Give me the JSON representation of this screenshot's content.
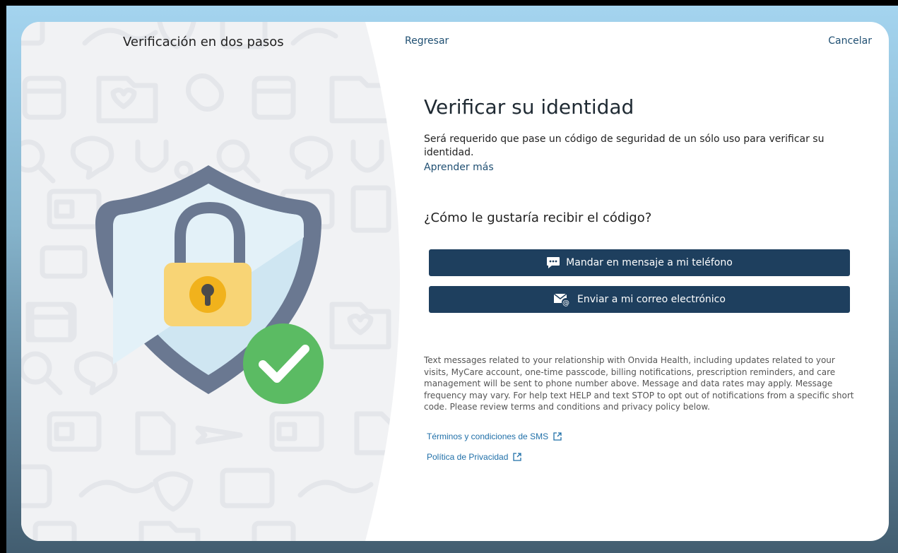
{
  "header": {
    "panel_title": "Verificación en dos pasos",
    "back_label": "Regresar",
    "cancel_label": "Cancelar"
  },
  "main": {
    "heading": "Verificar su identidad",
    "intro": "Será requerido que pase un código de seguridad de un sólo uso para verificar su identidad.",
    "learn_more": "Aprender más",
    "question": "¿Cómo le gustaría recibir el código?",
    "sms_button": {
      "label": "Mandar en mensaje a mi teléfono",
      "icon": "chat-bubble-icon"
    },
    "email_button": {
      "label": "Enviar a mi correo electrónico",
      "icon": "envelope-at-icon"
    }
  },
  "footer": {
    "disclaimer": "Text messages related to your relationship with Onvida Health, including updates related to your visits, MyCare account, one-time passcode, billing notifications, prescription reminders, and care management will be sent to phone number above. Message and data rates may apply. Message frequency may vary. For help text HELP and text STOP to opt out of notifications from a specific short code. Please review terms and conditions and privacy policy below.",
    "sms_terms": "Términos y condiciones de SMS",
    "privacy_policy": "Política de Privacidad"
  },
  "colors": {
    "primary_button": "#1e3f5e",
    "link": "#1f4f72",
    "shield_outer": "#6a7891",
    "shield_inner": "#cfe6f2",
    "lock_body": "#f8d475",
    "keyhole_ring": "#f1b21c",
    "check_badge": "#5bbb63"
  }
}
